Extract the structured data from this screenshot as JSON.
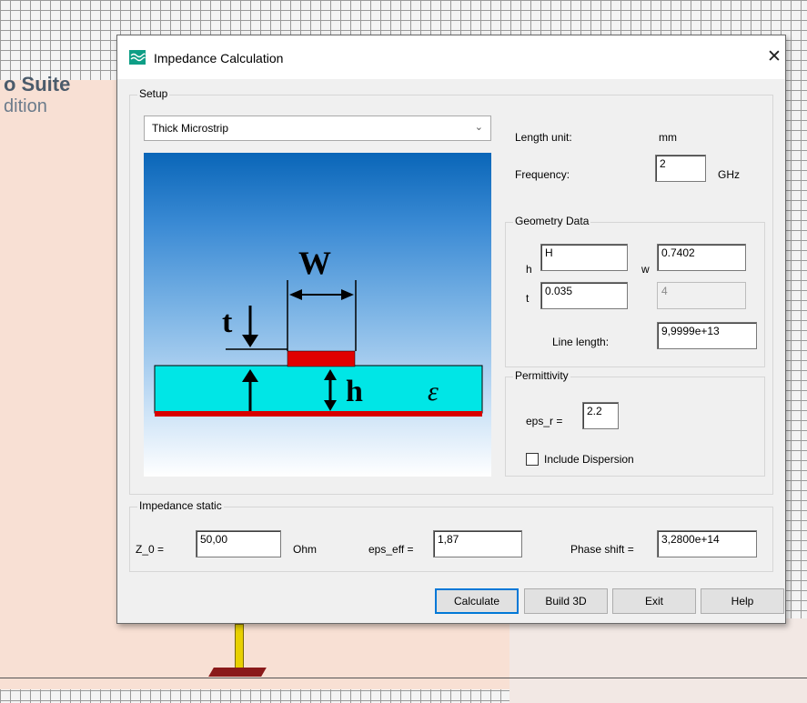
{
  "background": {
    "brand_line1": "o Suite",
    "brand_line2": "dition"
  },
  "dialog": {
    "title": "Impedance Calculation",
    "close_label": "✕"
  },
  "setup": {
    "group_label": "Setup",
    "line_type": "Thick Microstrip",
    "length_unit_label": "Length unit:",
    "length_unit_value": "mm",
    "frequency_label": "Frequency:",
    "frequency_value": "2",
    "frequency_unit": "GHz"
  },
  "diagram": {
    "width_symbol": "W",
    "thickness_symbol": "t",
    "height_symbol": "h",
    "permittivity_symbol": "ε"
  },
  "geometry": {
    "group_label": "Geometry Data",
    "h_label": "h",
    "h_value": "H",
    "w_label": "w",
    "w_value": "0.7402",
    "t_label": "t",
    "t_value": "0.035",
    "disabled_value": "4",
    "line_length_label": "Line length:",
    "line_length_value": "9,9999e+13"
  },
  "permittivity": {
    "group_label": "Permittivity",
    "eps_r_label": "eps_r =",
    "eps_r_value": "2.2",
    "dispersion_label": "Include Dispersion",
    "dispersion_checked": false
  },
  "impedance": {
    "group_label": "Impedance static",
    "z0_label": "Z_0 =",
    "z0_value": "50,00",
    "z0_unit": "Ohm",
    "eps_eff_label": "eps_eff =",
    "eps_eff_value": "1,87",
    "phase_label": "Phase shift =",
    "phase_value": "3,2800e+14"
  },
  "buttons": {
    "calculate": "Calculate",
    "build3d": "Build 3D",
    "exit": "Exit",
    "help": "Help"
  },
  "colors": {
    "accent": "#0078d7",
    "substrate": "#00e6e6",
    "conductor": "#e00000"
  }
}
